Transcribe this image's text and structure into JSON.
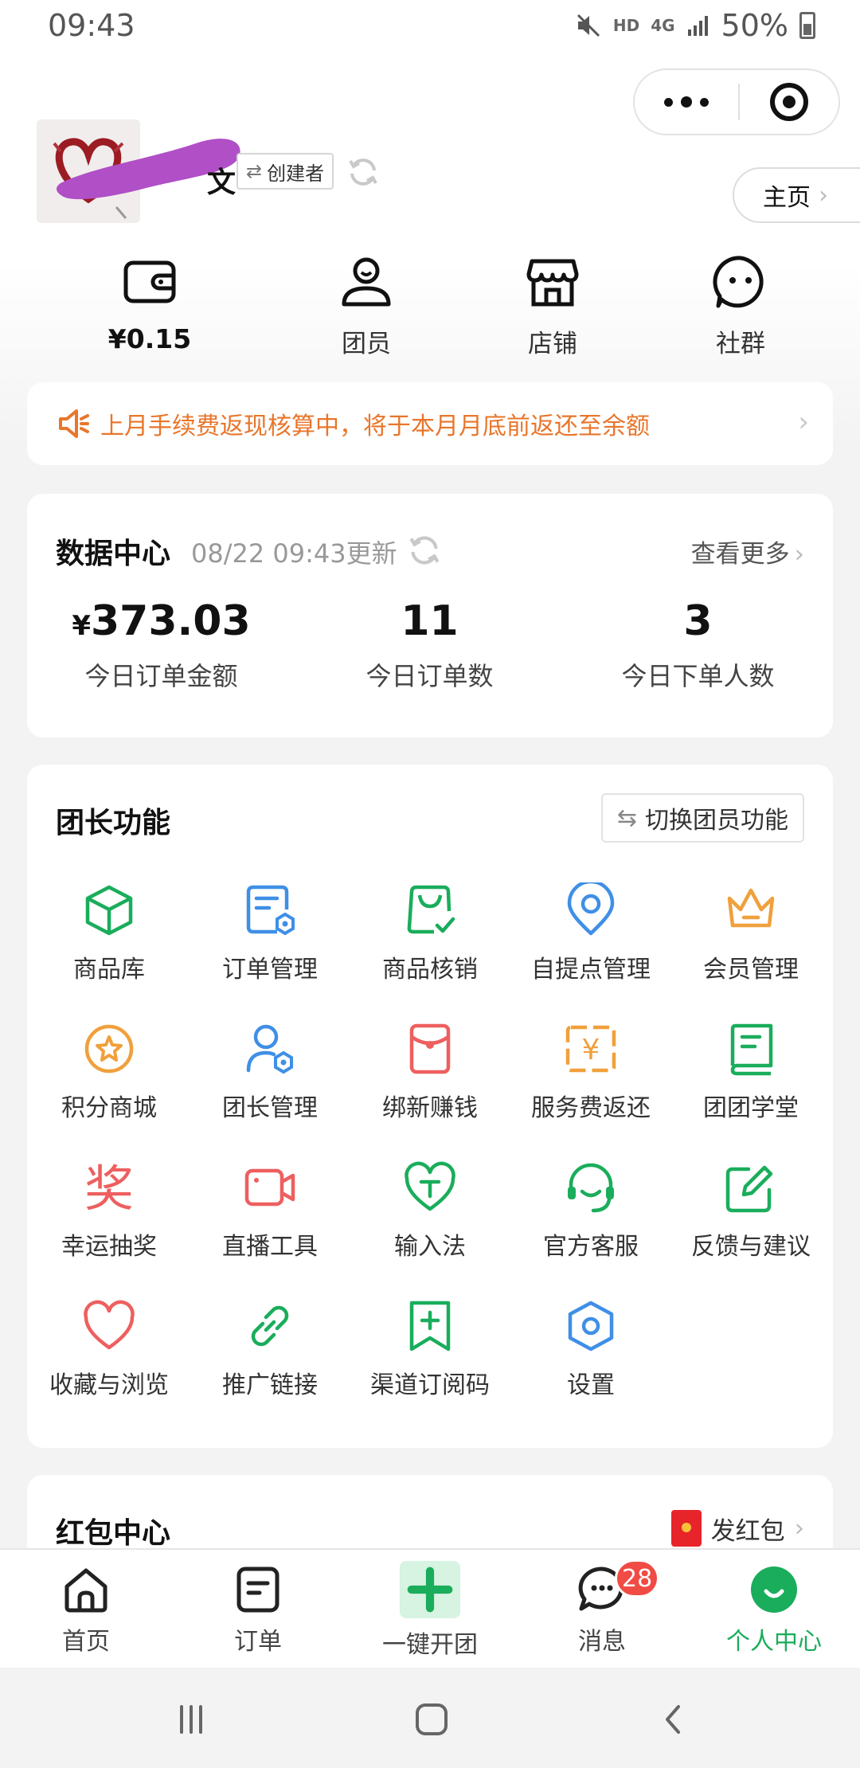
{
  "status_bar": {
    "time": "09:43",
    "hd": "HD",
    "network": "4G",
    "battery_pct": "50%"
  },
  "profile": {
    "name_tail": "文",
    "role_tag": "创建者",
    "home_button": "主页"
  },
  "quick": {
    "wallet_amount": "¥0.15",
    "members": "团员",
    "shop": "店铺",
    "community": "社群"
  },
  "notice": {
    "text": "上月手续费返现核算中，将于本月月底前返还至余额"
  },
  "data_center": {
    "title": "数据中心",
    "updated": "08/22 09:43更新",
    "more": "查看更多",
    "stats": [
      {
        "currency": "¥",
        "value": "373.03",
        "label": "今日订单金额"
      },
      {
        "currency": "",
        "value": "11",
        "label": "今日订单数"
      },
      {
        "currency": "",
        "value": "3",
        "label": "今日下单人数"
      }
    ]
  },
  "functions": {
    "title": "团长功能",
    "switch_label": "切换团员功能",
    "items": [
      {
        "label": "商品库",
        "icon": "cube-icon",
        "color": "#1aad5b"
      },
      {
        "label": "订单管理",
        "icon": "order-doc-icon",
        "color": "#3f8fe6"
      },
      {
        "label": "商品核销",
        "icon": "shopping-bag-check-icon",
        "color": "#1aad5b"
      },
      {
        "label": "自提点管理",
        "icon": "location-pin-icon",
        "color": "#3f8fe6"
      },
      {
        "label": "会员管理",
        "icon": "crown-icon",
        "color": "#f0a03c"
      },
      {
        "label": "积分商城",
        "icon": "star-coin-icon",
        "color": "#f0a03c"
      },
      {
        "label": "团长管理",
        "icon": "user-gear-icon",
        "color": "#3f8fe6"
      },
      {
        "label": "绑新赚钱",
        "icon": "red-envelope-icon",
        "color": "#ee5f5f"
      },
      {
        "label": "服务费返还",
        "icon": "yuan-ticket-icon",
        "color": "#f0a03c"
      },
      {
        "label": "团团学堂",
        "icon": "book-icon",
        "color": "#1aad5b"
      },
      {
        "label": "幸运抽奖",
        "icon": "prize-icon",
        "color": "#ee5f5f"
      },
      {
        "label": "直播工具",
        "icon": "video-camera-icon",
        "color": "#ee5f5f"
      },
      {
        "label": "输入法",
        "icon": "heart-t-icon",
        "color": "#1aad5b"
      },
      {
        "label": "官方客服",
        "icon": "headset-icon",
        "color": "#1aad5b"
      },
      {
        "label": "反馈与建议",
        "icon": "edit-icon",
        "color": "#1aad5b"
      },
      {
        "label": "收藏与浏览",
        "icon": "heart-icon",
        "color": "#ee5f5f"
      },
      {
        "label": "推广链接",
        "icon": "link-icon",
        "color": "#1aad5b"
      },
      {
        "label": "渠道订阅码",
        "icon": "bookmark-plus-icon",
        "color": "#1aad5b"
      },
      {
        "label": "设置",
        "icon": "settings-hex-icon",
        "color": "#3f8fe6"
      }
    ],
    "prize_glyph": "奖",
    "yuan_glyph": "¥"
  },
  "red_packet": {
    "title": "红包中心",
    "send_label": "发红包"
  },
  "tabbar": {
    "home": "首页",
    "orders": "订单",
    "create_group": "一键开团",
    "messages": "消息",
    "messages_badge": "28",
    "profile": "个人中心"
  },
  "colors": {
    "accent_green": "#1aad5b",
    "notice_orange": "#e8762b",
    "badge_red": "#f04b44"
  }
}
